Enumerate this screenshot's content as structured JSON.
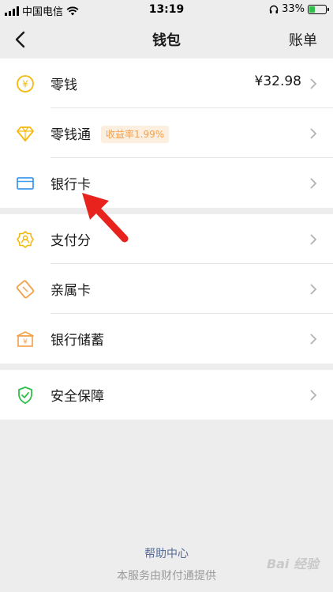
{
  "status": {
    "carrier": "中国电信",
    "time": "13:19",
    "battery": "33%"
  },
  "nav": {
    "title": "钱包",
    "right": "账单"
  },
  "groups": [
    {
      "items": [
        {
          "label": "零钱",
          "amount": "¥32.98",
          "icon": "coin-icon"
        },
        {
          "label": "零钱通",
          "badge": "收益率1.99%",
          "icon": "diamond-icon"
        },
        {
          "label": "银行卡",
          "icon": "bank-card-icon"
        }
      ]
    },
    {
      "items": [
        {
          "label": "支付分",
          "icon": "credit-score-icon"
        },
        {
          "label": "亲属卡",
          "icon": "family-card-icon"
        },
        {
          "label": "银行储蓄",
          "icon": "savings-icon"
        }
      ]
    },
    {
      "items": [
        {
          "label": "安全保障",
          "icon": "shield-icon"
        }
      ]
    }
  ],
  "footer": {
    "help": "帮助中心",
    "provider": "本服务由财付通提供"
  },
  "watermark": "Bai 经验",
  "colors": {
    "background": "#ededed",
    "accent_yellow": "#f5b80b",
    "accent_orange": "#f2a04a",
    "accent_blue": "#3e9bf0",
    "accent_green": "#2fbf4a",
    "link": "#576b95"
  }
}
